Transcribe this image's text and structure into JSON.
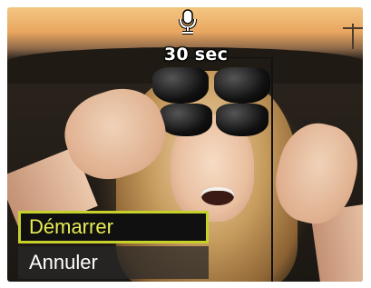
{
  "recording": {
    "icon": "microphone-icon",
    "duration_label": "30 sec"
  },
  "menu": {
    "items": [
      {
        "label": "Démarrer",
        "selected": true
      },
      {
        "label": "Annuler",
        "selected": false
      }
    ],
    "highlight_color": "#c7d12c",
    "selected_text_color": "#e8ec52"
  }
}
